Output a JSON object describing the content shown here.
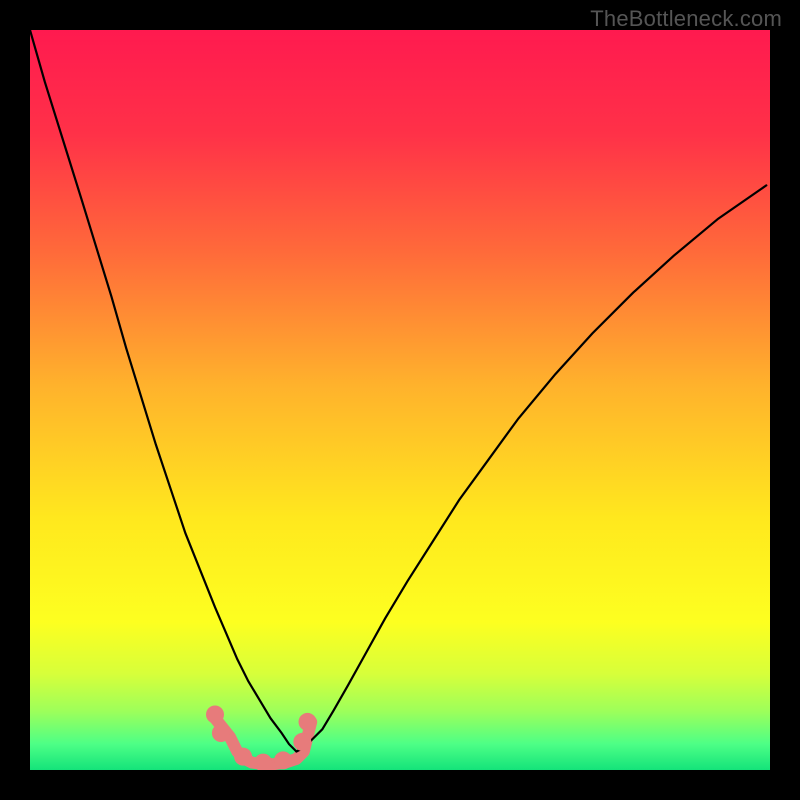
{
  "watermark": "TheBottleneck.com",
  "gradient": {
    "stops": [
      {
        "offset": 0.0,
        "color": "#ff1a4f"
      },
      {
        "offset": 0.14,
        "color": "#ff3148"
      },
      {
        "offset": 0.3,
        "color": "#ff6a3a"
      },
      {
        "offset": 0.48,
        "color": "#ffb22c"
      },
      {
        "offset": 0.66,
        "color": "#ffe81e"
      },
      {
        "offset": 0.8,
        "color": "#fdff20"
      },
      {
        "offset": 0.87,
        "color": "#d7ff3a"
      },
      {
        "offset": 0.92,
        "color": "#9eff5a"
      },
      {
        "offset": 0.965,
        "color": "#4dff86"
      },
      {
        "offset": 1.0,
        "color": "#14e37a"
      }
    ]
  },
  "chart_data": {
    "type": "line",
    "title": "",
    "xlabel": "",
    "ylabel": "",
    "xrange": [
      0,
      100
    ],
    "yrange": [
      0,
      100
    ],
    "series": [
      {
        "name": "curve-left",
        "x": [
          0.0,
          2.0,
          4.5,
          7.0,
          9.0,
          11.0,
          13.0,
          15.0,
          17.0,
          19.0,
          21.0,
          23.0,
          25.0,
          26.5,
          28.0,
          29.5,
          31.0,
          32.5,
          34.0,
          35.0,
          36.0
        ],
        "y": [
          100.0,
          93.0,
          85.0,
          77.0,
          70.5,
          64.0,
          57.0,
          50.5,
          44.0,
          38.0,
          32.0,
          27.0,
          22.0,
          18.5,
          15.0,
          12.0,
          9.5,
          7.0,
          5.0,
          3.5,
          2.5
        ]
      },
      {
        "name": "curve-right",
        "x": [
          36.0,
          37.0,
          38.0,
          39.5,
          41.0,
          43.0,
          45.5,
          48.0,
          51.0,
          54.5,
          58.0,
          62.0,
          66.0,
          71.0,
          76.0,
          81.5,
          87.0,
          93.0,
          99.5
        ],
        "y": [
          2.5,
          3.0,
          4.0,
          5.5,
          8.0,
          11.5,
          16.0,
          20.5,
          25.5,
          31.0,
          36.5,
          42.0,
          47.5,
          53.5,
          59.0,
          64.5,
          69.5,
          74.5,
          79.0
        ]
      },
      {
        "name": "bottom-lobe",
        "x": [
          25.0,
          27.0,
          28.0,
          29.0,
          30.0,
          31.5,
          33.0,
          34.5,
          36.0,
          37.0,
          38.0
        ],
        "y": [
          7.0,
          4.5,
          2.5,
          1.5,
          1.0,
          0.8,
          0.8,
          1.0,
          1.5,
          2.5,
          6.5
        ]
      }
    ],
    "points": [
      {
        "x": 25.0,
        "y": 7.5
      },
      {
        "x": 25.8,
        "y": 5.0
      },
      {
        "x": 28.8,
        "y": 1.8
      },
      {
        "x": 31.5,
        "y": 1.0
      },
      {
        "x": 34.2,
        "y": 1.3
      },
      {
        "x": 36.8,
        "y": 3.8
      },
      {
        "x": 37.5,
        "y": 6.5
      }
    ],
    "colors": {
      "curve": "#000000",
      "lobe": "#e77b7b",
      "point": "#e77b7b"
    }
  }
}
